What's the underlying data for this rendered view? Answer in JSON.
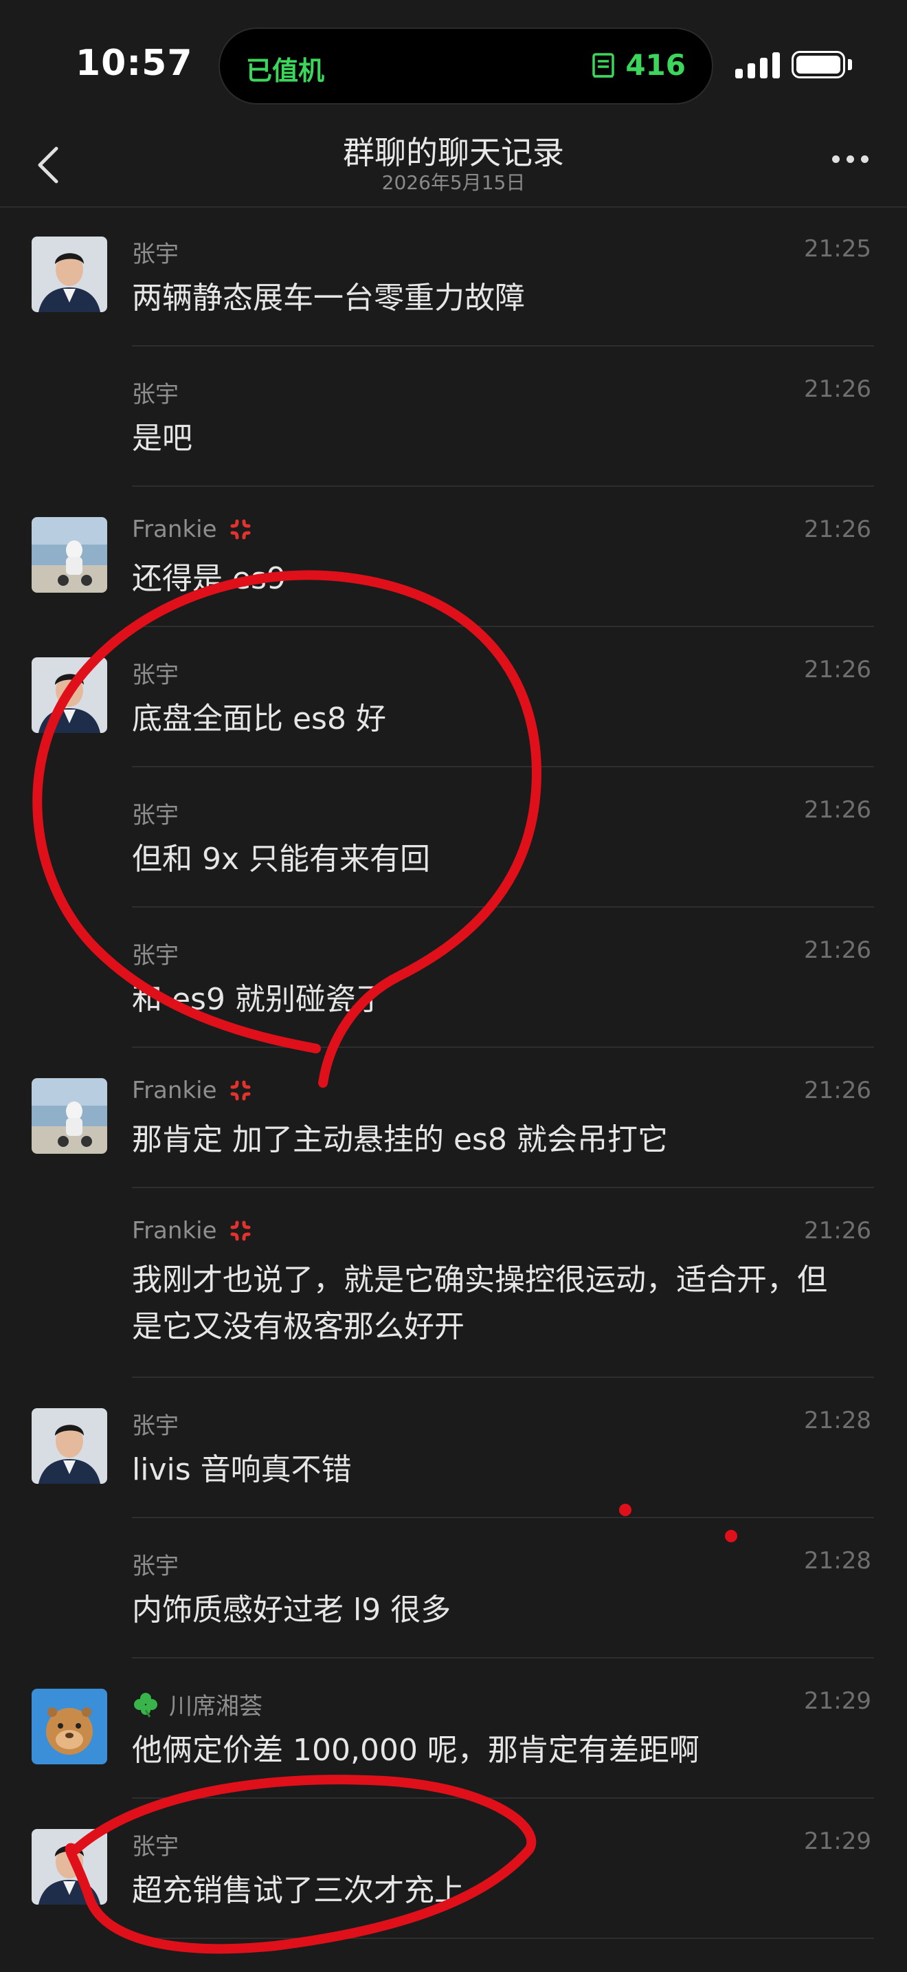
{
  "status_bar": {
    "time": "10:57",
    "island_left": "已值机",
    "island_right": "416",
    "island_icon": "boarding-pass-icon",
    "signal": "cellular-signal-icon",
    "battery": "battery-full-icon"
  },
  "nav": {
    "title": "群聊的聊天记录",
    "subtitle": "2026年5月15日",
    "back_icon": "chevron-left-icon",
    "more_icon": "more-dots-icon"
  },
  "messages": [
    {
      "sender": "张宇",
      "time": "21:25",
      "text": "两辆静态展车一台零重力故障",
      "avatar": "zhangyu"
    },
    {
      "sender": "张宇",
      "time": "21:26",
      "text": "是吧",
      "avatar": ""
    },
    {
      "sender": "Frankie",
      "time": "21:26",
      "text": "还得是 es9",
      "avatar": "frankie",
      "emoji": "anger-icon"
    },
    {
      "sender": "张宇",
      "time": "21:26",
      "text": "底盘全面比 es8 好",
      "avatar": "zhangyu"
    },
    {
      "sender": "张宇",
      "time": "21:26",
      "text": "但和 9x 只能有来有回",
      "avatar": ""
    },
    {
      "sender": "张宇",
      "time": "21:26",
      "text": "和 es9 就别碰瓷了",
      "avatar": ""
    },
    {
      "sender": "Frankie",
      "time": "21:26",
      "text": "那肯定 加了主动悬挂的 es8 就会吊打它",
      "avatar": "frankie",
      "emoji": "anger-icon"
    },
    {
      "sender": "Frankie",
      "time": "21:26",
      "text": "我刚才也说了，就是它确实操控很运动，适合开，但是它又没有极客那么好开",
      "avatar": "",
      "emoji": "anger-icon"
    },
    {
      "sender": "张宇",
      "time": "21:28",
      "text": "livis 音响真不错",
      "avatar": "zhangyu"
    },
    {
      "sender": "张宇",
      "time": "21:28",
      "text": "内饰质感好过老 l9 很多",
      "avatar": ""
    },
    {
      "sender": "川席湘荟",
      "time": "21:29",
      "text": "他俩定价差 100,000 呢，那肯定有差距啊",
      "avatar": "capybara",
      "emoji": "clover-icon",
      "emoji_before": true
    },
    {
      "sender": "张宇",
      "time": "21:29",
      "text": "超充销售试了三次才充上",
      "avatar": "zhangyu"
    }
  ],
  "colors": {
    "background": "#1b1b1b",
    "island_green": "#3dd65c",
    "annotation_red": "#e0101a"
  }
}
